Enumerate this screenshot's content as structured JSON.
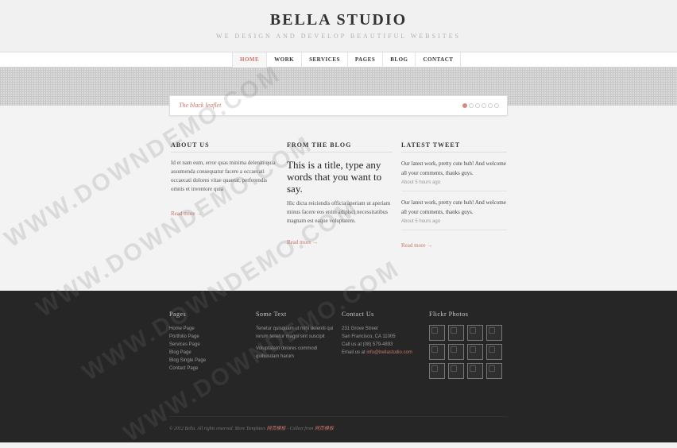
{
  "header": {
    "title": "BELLA STUDIO",
    "tagline": "WE DESIGN AND DEVELOP BEAUTIFUL WEBSITES"
  },
  "nav": {
    "items": [
      {
        "label": "HOME",
        "active": true
      },
      {
        "label": "WORK"
      },
      {
        "label": "SERVICES"
      },
      {
        "label": "PAGES"
      },
      {
        "label": "BLOG"
      },
      {
        "label": "CONTACT"
      }
    ]
  },
  "slider": {
    "caption": "The black leaflet",
    "dots": 6,
    "active_dot": 1
  },
  "about": {
    "heading": "ABOUT US",
    "text": "Id et nam eum, error quas minima deleniti quia assumenda consequatur facere a occaecati occaecati dolores vitae quaerat, perferendis omnis et inventore quia",
    "read_more": "Read more →"
  },
  "blog": {
    "heading": "FROM THE BLOG",
    "title": "This is a title, type any words that you want to say.",
    "text": "Hic dicta reiciendis officia aperiam ut aperiam minus facere eos enim adipisci necessitatibus magnam est eaque voluptatem.",
    "read_more": "Read more →"
  },
  "tweets": {
    "heading": "LATEST TWEET",
    "items": [
      {
        "text": "Our latest work, pretty cute huh! And welcome all your comments, thanks guys.",
        "time": "About 5 hours ago"
      },
      {
        "text": "Our latest work, pretty cute huh! And welcome all your comments, thanks guys.",
        "time": "About 5 hours ago"
      }
    ],
    "read_more": "Read more →"
  },
  "footer": {
    "pages": {
      "heading": "Pages",
      "links": [
        "Home Page",
        "Portfolio Page",
        "Services Page",
        "Blog Page",
        "Blog Single Page",
        "Contact Page"
      ]
    },
    "some_text": {
      "heading": "Some Text",
      "p1": "Tenetur quisquam ut mihi deleniti qui rerum tenetur magni sint suscipit",
      "p2": "Voluptatem dolores commodi quibusdam harum"
    },
    "contact": {
      "heading": "Contact Us",
      "address1": "231 Grove Street",
      "address2": "San Francisco, CA 11005",
      "phone": "Call us at (08) 579-4893",
      "email_prefix": "Email us at ",
      "email": "info@bellastudio.com"
    },
    "flickr": {
      "heading": "Flickr Photos",
      "count": 12
    },
    "copyright": {
      "text": "© 2012 Bella. All rights reserved. More Templates ",
      "link1": "网页模板",
      "mid": " - Collect from ",
      "link2": "网页模板"
    }
  },
  "watermark": "WWW.DOWNDEMO.COM",
  "colors": {
    "accent": "#c9756a",
    "footer_bg": "#262626",
    "page_bg": "#f3f3f3"
  }
}
